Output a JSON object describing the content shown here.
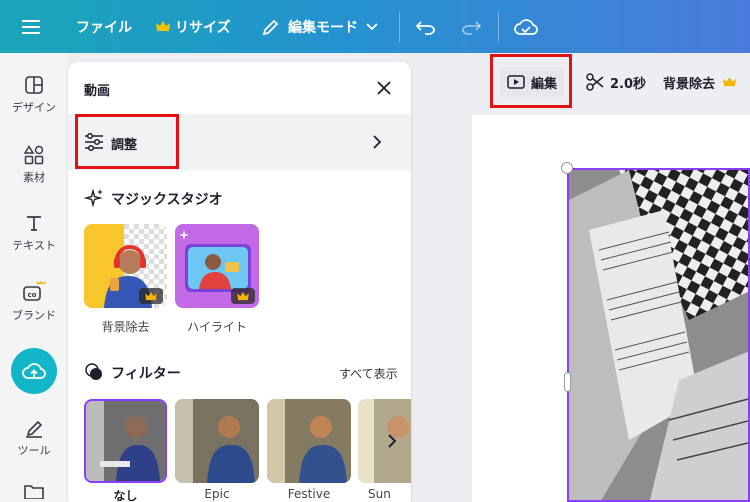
{
  "topbar": {
    "file_label": "ファイル",
    "resize_label": "リサイズ",
    "edit_mode_label": "編集モード"
  },
  "rail": {
    "items": [
      {
        "label": "デザイン"
      },
      {
        "label": "素材"
      },
      {
        "label": "テキスト"
      },
      {
        "label": "ブランド"
      },
      {
        "label": "ツール"
      }
    ]
  },
  "panel": {
    "title": "動画",
    "adjust_label": "調整",
    "magic_studio_title": "マジックスタジオ",
    "magic_items": [
      {
        "label": "背景除去"
      },
      {
        "label": "ハイライト"
      }
    ],
    "filter_title": "フィルター",
    "show_all_label": "すべて表示",
    "filters": [
      {
        "label": "なし"
      },
      {
        "label": "Epic"
      },
      {
        "label": "Festive"
      },
      {
        "label": "Sun"
      }
    ]
  },
  "context_bar": {
    "edit_label": "編集",
    "duration_label": "2.0秒",
    "bg_remove_label": "背景除去"
  },
  "colors": {
    "accent": "#8b3dff",
    "highlight": "#e11212",
    "upload": "#13b5c8",
    "crown": "#f5b400"
  }
}
